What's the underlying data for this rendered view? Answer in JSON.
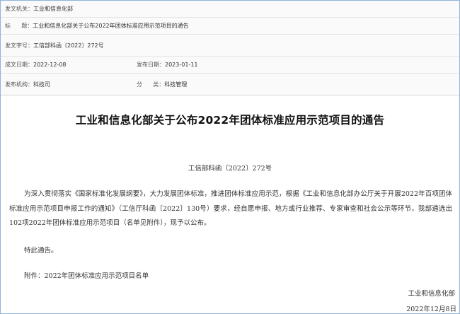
{
  "meta": {
    "issuer_label": "发文机关：",
    "issuer": "工业和信息化部",
    "title_label": "标      题：",
    "title": "工业和信息化部关于公布2022年团体标准应用示范项目的通告",
    "docno_label": "发文字号：",
    "docno": "工信部科函〔2022〕272号",
    "written_label": "成文日期：",
    "written": "2022-12-08",
    "published_label": "发布日期：",
    "published": "2023-01-11",
    "org_label": "发布机构：",
    "org": "科技司",
    "category_label": "分      类：",
    "category": "科技管理"
  },
  "document": {
    "heading": "工业和信息化部关于公布2022年团体标准应用示范项目的通告",
    "docno": "工信部科函〔2022〕272号",
    "paragraph1": "为深入贯彻落实《国家标准化发展纲要》，大力发展团体标准，推进团体标准应用示范，根据《工业和信息化部办公厅关于开展2022年百项团体标准应用示范项目申报工作的通知》（工信厅科函〔2022〕130号）要求，经自愿申报、地方或行业推荐、专家审查和社会公示等环节，我部遴选出102项2022年团体标准应用示范项目（名单见附件），现予以公布。",
    "paragraph2": "特此通告。",
    "attachment": "附件：2022年团体标准应用示范项目名单",
    "signer": "工业和信息化部",
    "date": "2022年12月8日"
  }
}
